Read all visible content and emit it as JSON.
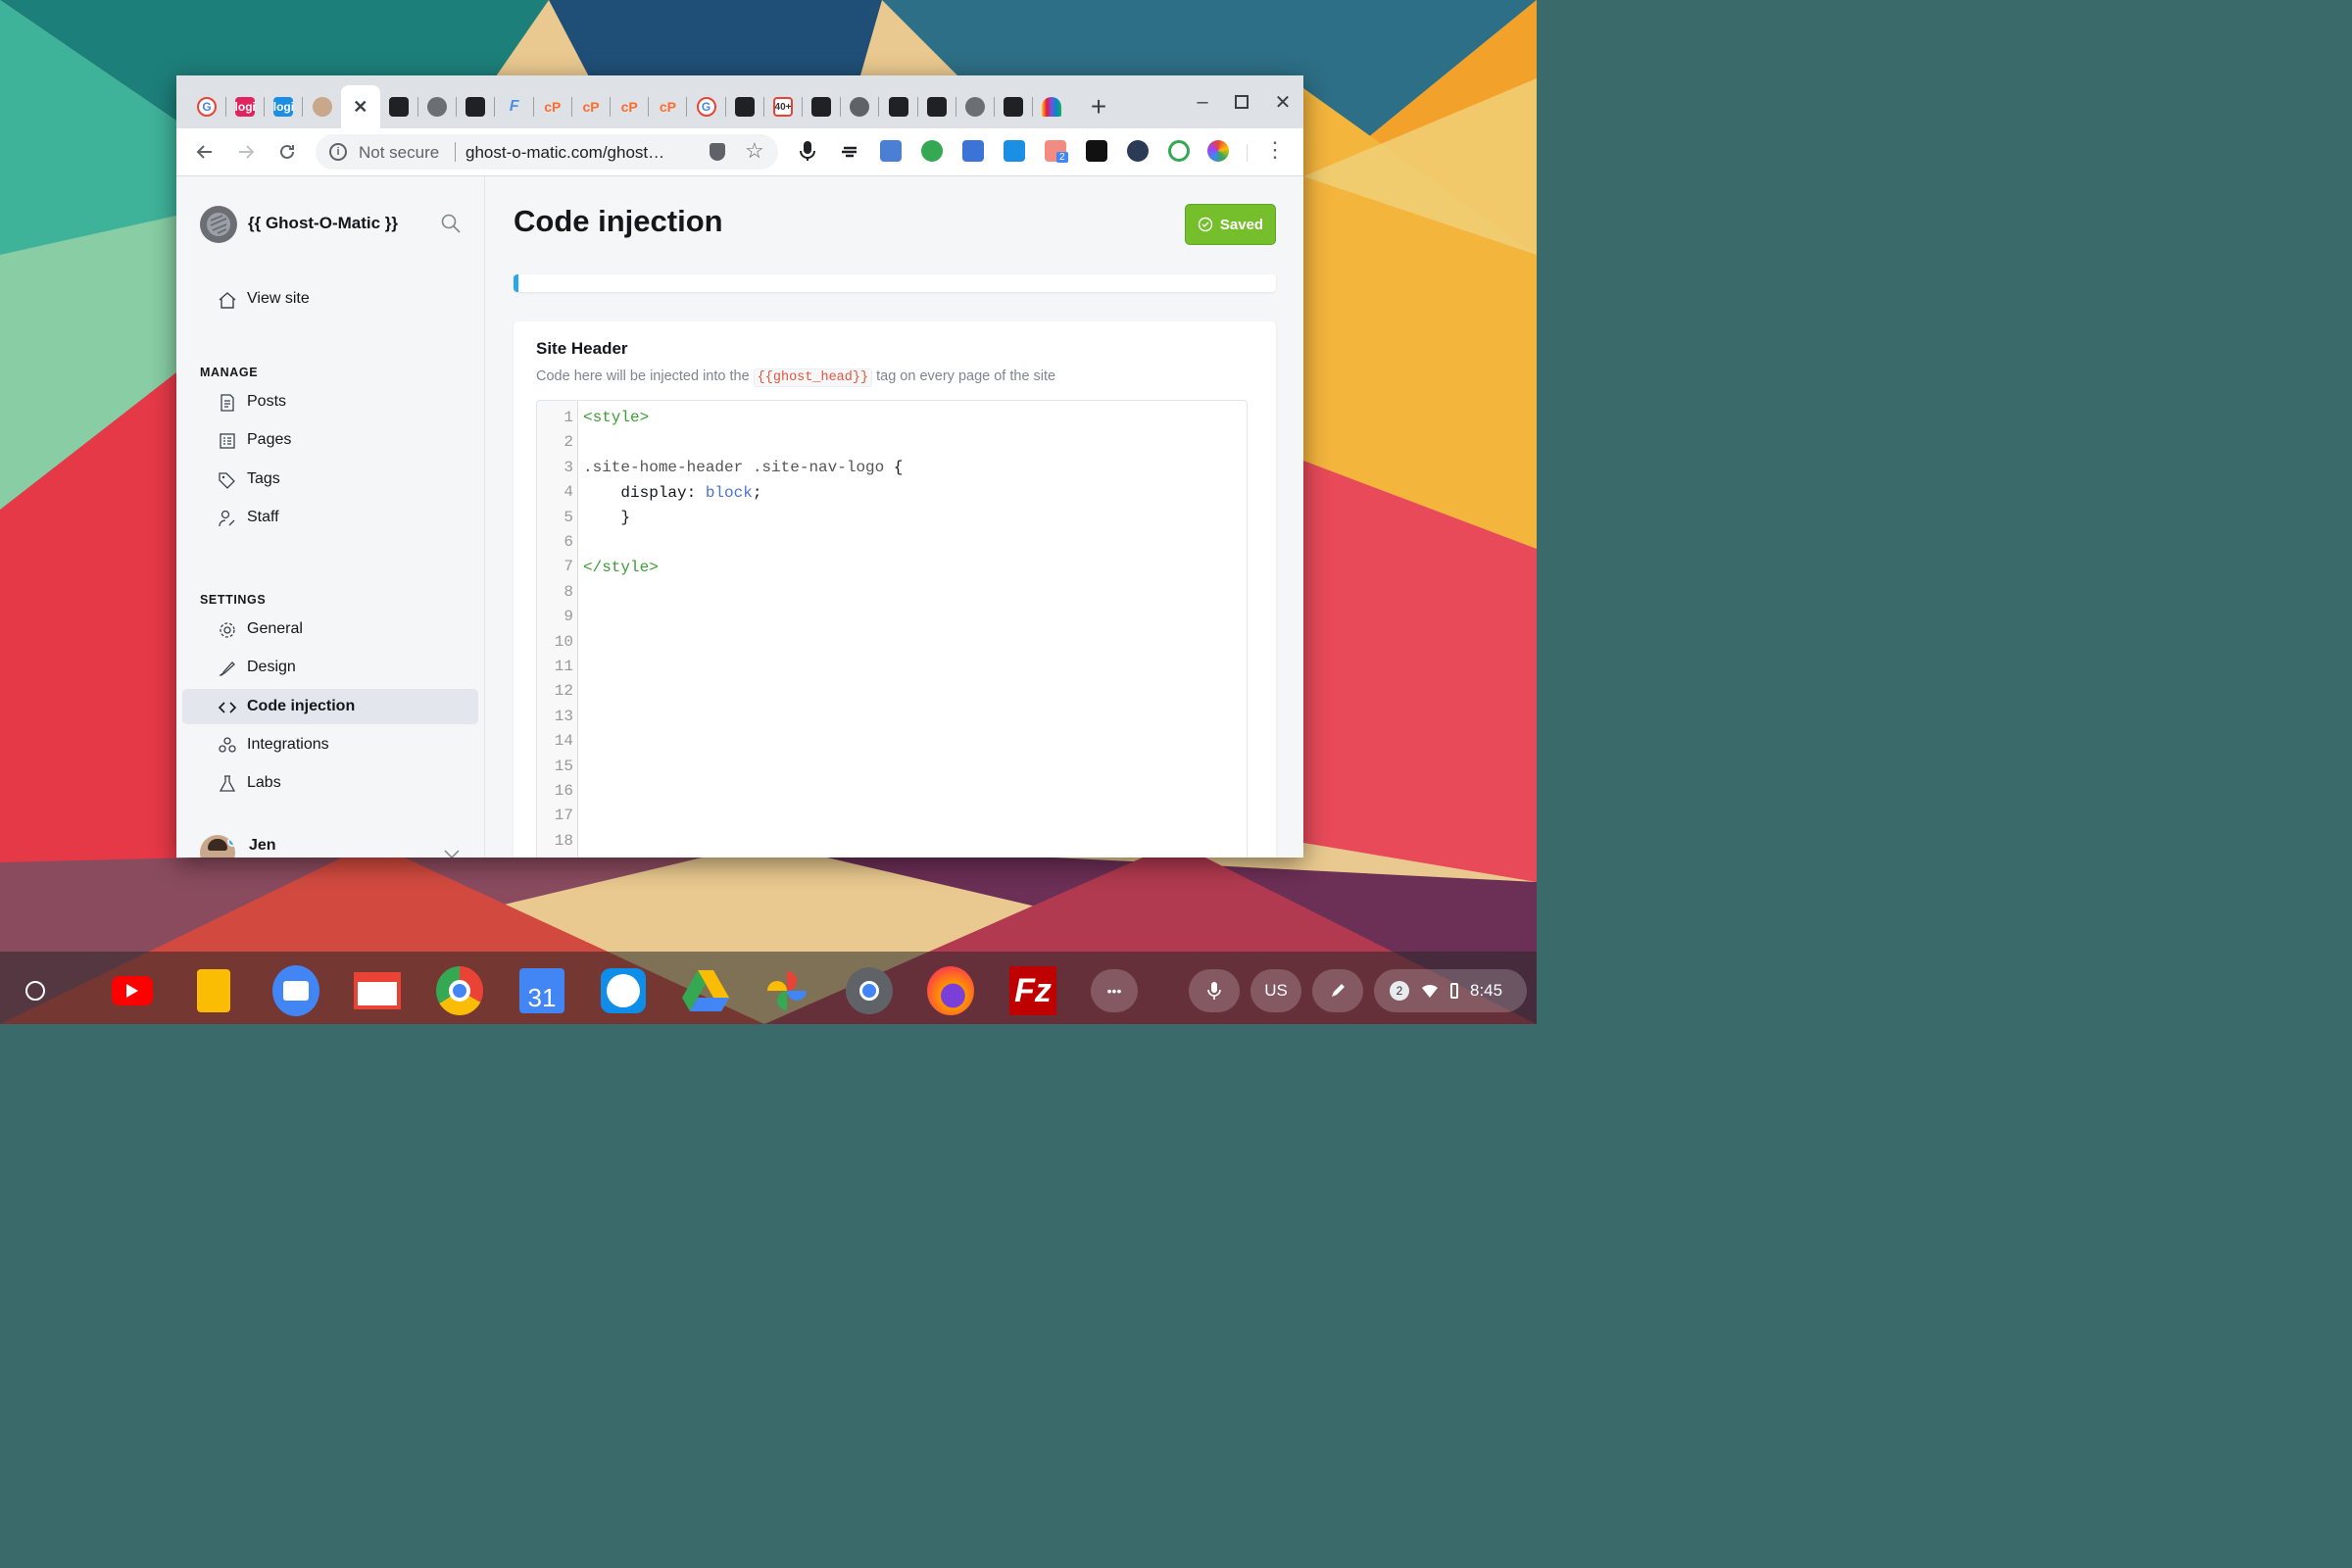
{
  "browser": {
    "tabs": [
      {
        "icon": "google-icon"
      },
      {
        "icon": "logi-red-icon",
        "text": "logi"
      },
      {
        "icon": "logi-blue-icon",
        "text": "logi"
      },
      {
        "icon": "avatar-icon"
      },
      {
        "icon": "close-icon",
        "active": true
      },
      {
        "icon": "doc-icon"
      },
      {
        "icon": "ghost-icon"
      },
      {
        "icon": "doc-icon"
      },
      {
        "icon": "f-icon"
      },
      {
        "icon": "cpanel-icon"
      },
      {
        "icon": "cpanel-icon"
      },
      {
        "icon": "cpanel-icon"
      },
      {
        "icon": "cpanel-icon"
      },
      {
        "icon": "google-icon"
      },
      {
        "icon": "doc-icon"
      },
      {
        "icon": "gmail-icon",
        "text": "40+"
      },
      {
        "icon": "doc-icon"
      },
      {
        "icon": "globe-icon"
      },
      {
        "icon": "doc-icon"
      },
      {
        "icon": "doc-icon"
      },
      {
        "icon": "ghost-icon"
      },
      {
        "icon": "doc-icon"
      },
      {
        "icon": "peacock-icon"
      }
    ],
    "new_tab": "+",
    "not_secure": "Not secure",
    "url": "ghost-o-matic.com/ghost…",
    "extensions_badge": "2"
  },
  "sidebar": {
    "site_name": "{{ Ghost-O-Matic }}",
    "view_site": "View site",
    "manage_label": "MANAGE",
    "manage": [
      {
        "icon": "posts-icon",
        "label": "Posts"
      },
      {
        "icon": "pages-icon",
        "label": "Pages"
      },
      {
        "icon": "tag-icon",
        "label": "Tags"
      },
      {
        "icon": "staff-icon",
        "label": "Staff"
      }
    ],
    "settings_label": "SETTINGS",
    "settings": [
      {
        "icon": "gear-icon",
        "label": "General"
      },
      {
        "icon": "brush-icon",
        "label": "Design"
      },
      {
        "icon": "code-icon",
        "label": "Code injection",
        "active": true
      },
      {
        "icon": "integrations-icon",
        "label": "Integrations"
      },
      {
        "icon": "flask-icon",
        "label": "Labs"
      }
    ],
    "user": "Jen"
  },
  "main": {
    "title": "Code injection",
    "saved": "Saved",
    "section_title": "Site Header",
    "desc_before": "Code here will be injected into the",
    "desc_code": "{{ghost_head}}",
    "desc_after": "tag on every page of the site",
    "line_numbers": [
      "1",
      "2",
      "3",
      "4",
      "5",
      "6",
      "7",
      "8",
      "9",
      "10",
      "11",
      "12",
      "13",
      "14",
      "15",
      "16",
      "17",
      "18"
    ],
    "code": {
      "l1": "<style>",
      "l3_sel": ".site-home-header .site-nav-logo",
      "l3_brace": " {",
      "l4_prop": "    display:",
      "l4_val": " block",
      "l4_semi": ";",
      "l5": "    }",
      "l7": "</style>"
    }
  },
  "shelf": {
    "apps": [
      "youtube-icon",
      "keep-icon",
      "files-icon",
      "gmail-icon",
      "chrome-icon",
      "calendar-icon",
      "teamviewer-icon",
      "drive-icon",
      "photos-icon",
      "camera-icon",
      "firefox-icon",
      "filezilla-icon",
      "more-icon"
    ],
    "calendar_day": "31",
    "more": "•••",
    "ime": "US",
    "notif_count": "2",
    "time": "8:45"
  },
  "colors": {
    "accent": "#75be2c",
    "progress": "#2aa7e9",
    "code_tag": "#3e9c35",
    "code_value": "#4f73c9",
    "code_hl": "#e25440"
  }
}
